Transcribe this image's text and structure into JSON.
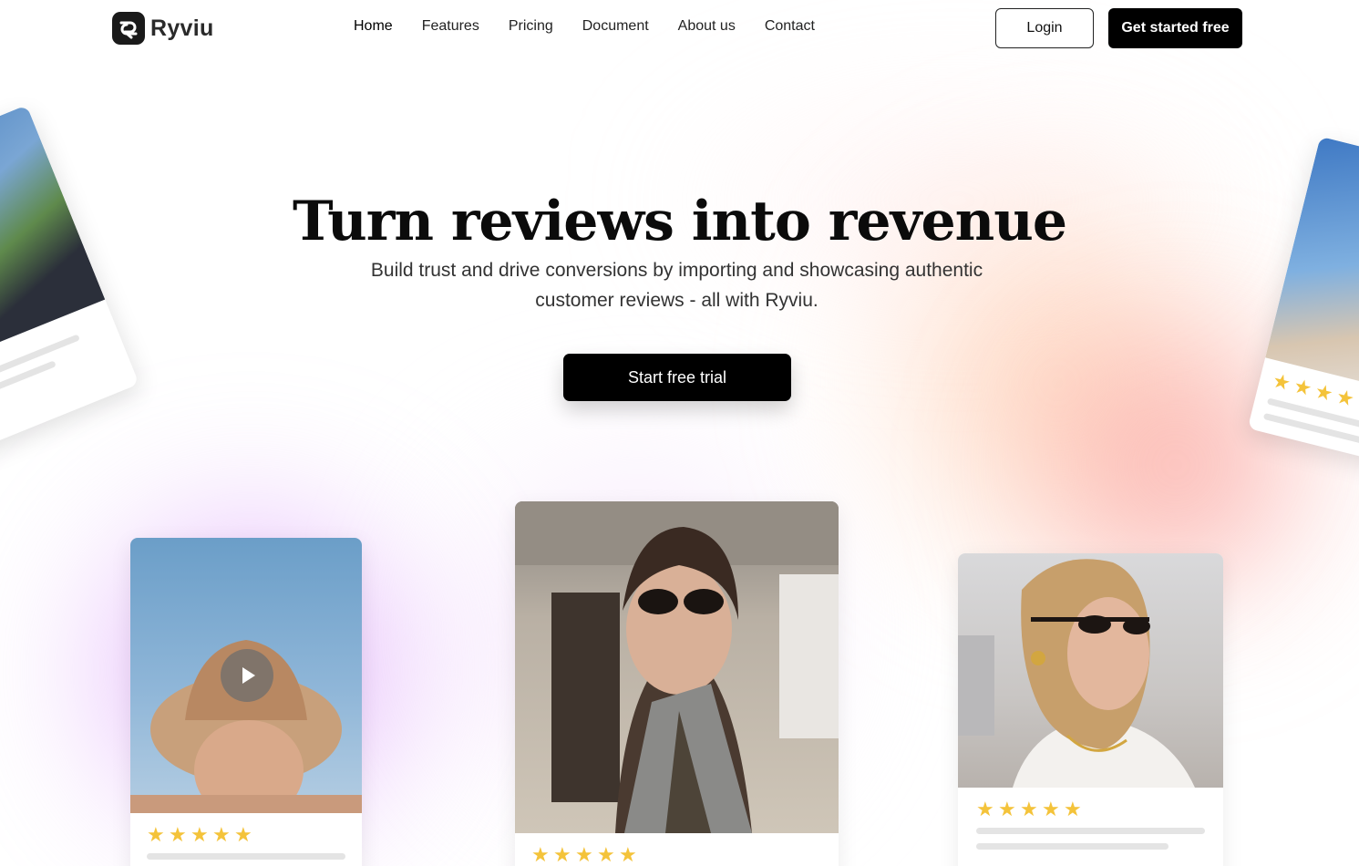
{
  "header": {
    "brand": "Ryviu",
    "nav": [
      {
        "label": "Home"
      },
      {
        "label": "Features"
      },
      {
        "label": "Pricing"
      },
      {
        "label": "Document"
      },
      {
        "label": "About us"
      },
      {
        "label": "Contact"
      }
    ],
    "login_label": "Login",
    "get_started_label": "Get started free"
  },
  "hero": {
    "title": "Turn reviews into revenue",
    "subtitle_line1": "Build trust and drive conversions by importing and showcasing authentic",
    "subtitle_line2": "customer reviews - all with Ryviu.",
    "cta_label": "Start free trial"
  },
  "icons": {
    "logo": "ryviu-logo-icon",
    "play": "play-icon",
    "star": "star-icon"
  },
  "colors": {
    "accent": "#000000",
    "star": "#f4c33a",
    "glow_purple": "#cd82f5",
    "glow_coral": "#fa8c8c",
    "glow_peach": "#ffc4a0"
  },
  "review_cards": [
    {
      "id": "left",
      "rating": 5,
      "has_video": true
    },
    {
      "id": "middle",
      "rating": 5,
      "has_video": false
    },
    {
      "id": "right",
      "rating": 5,
      "has_video": false
    }
  ]
}
